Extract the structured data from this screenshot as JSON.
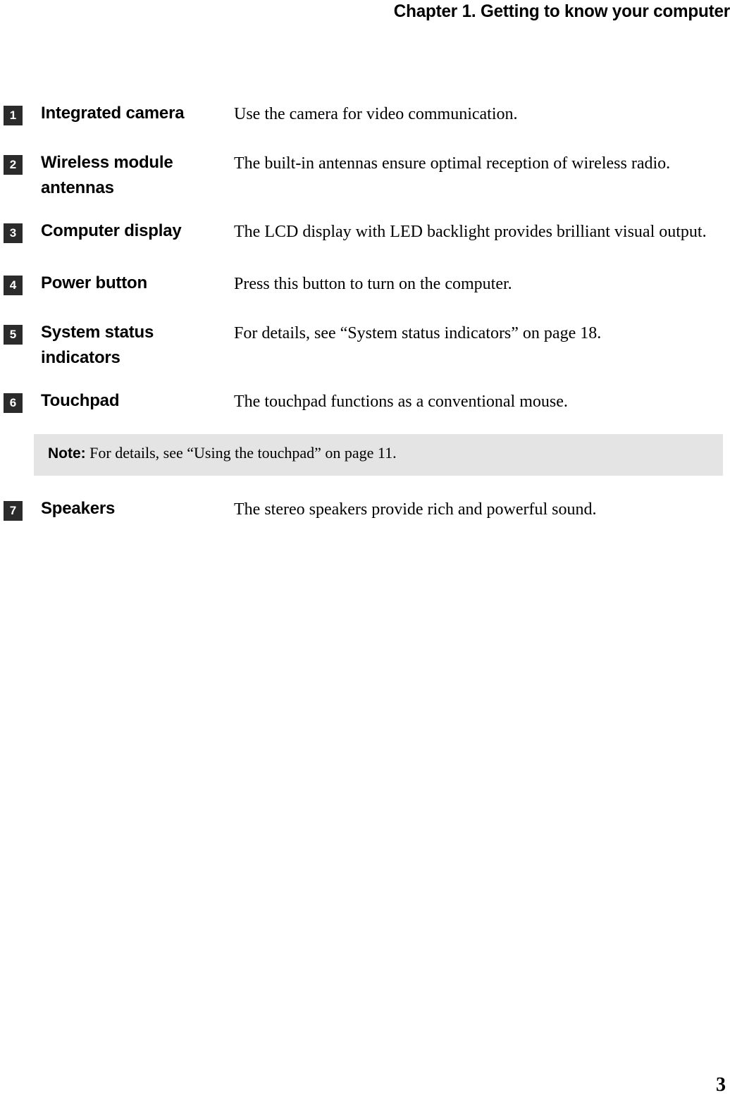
{
  "header": {
    "title": "Chapter 1. Getting to know your computer"
  },
  "table": {
    "rows": [
      {
        "number": "1",
        "label": "Integrated camera",
        "description": "Use the camera for video communication."
      },
      {
        "number": "2",
        "label": "Wireless module antennas",
        "description": "The built-in antennas ensure optimal reception of wireless radio."
      },
      {
        "number": "3",
        "label": "Computer display",
        "description": "The LCD display with LED backlight provides brilliant visual output."
      },
      {
        "number": "4",
        "label": "Power button",
        "description": "Press this button to turn on the computer."
      },
      {
        "number": "5",
        "label": "System status indicators",
        "description": "For details, see “System status indicators” on page 18."
      },
      {
        "number": "6",
        "label": "Touchpad",
        "description": "The touchpad functions as a conventional mouse."
      },
      {
        "number": "7",
        "label": "Speakers",
        "description": "The stereo speakers provide rich and powerful sound."
      }
    ]
  },
  "note": {
    "keyword": "Note:",
    "text": "For details, see “Using the touchpad” on page 11.",
    "background_color": "#e4e4e4"
  },
  "footer": {
    "page_number": "3"
  },
  "colors": {
    "badge_background": "#2b2b2b",
    "badge_text": "#ffffff",
    "page_background": "#ffffff",
    "body_text": "#000000"
  }
}
